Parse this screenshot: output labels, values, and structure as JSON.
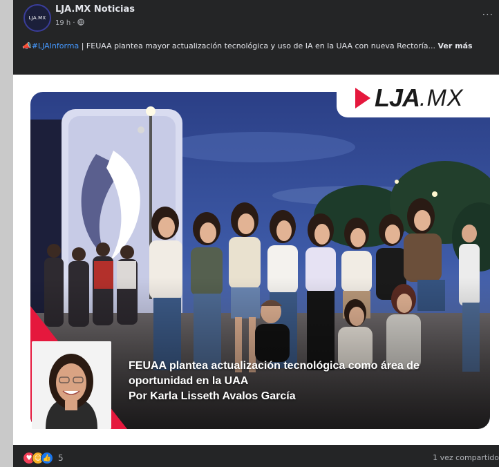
{
  "post": {
    "page_name": "LJA.MX Noticias",
    "avatar_text": "LJA.MX",
    "time": "19 h",
    "separator": " · ",
    "more_icon": "more-horizontal-icon",
    "emoji": "📣",
    "hashtag": "#LJAInforma",
    "text_after_hashtag": " | FEUAA plantea mayor actualización tecnológica y uso de IA en la UAA con nueva Rectoría...",
    "see_more": "Ver más"
  },
  "media": {
    "logo_main": "LJA",
    "logo_suffix": ".MX",
    "caption_line1": "FEUAA plantea actualización tecnológica como área de",
    "caption_line2": "oportunidad en la UAA",
    "caption_line3": "Por Karla Lisseth Avalos García"
  },
  "footer": {
    "reaction_count": "5",
    "reactions": [
      "love",
      "care",
      "like"
    ],
    "shares": "1 vez compartido"
  },
  "colors": {
    "card_bg": "#242526",
    "hashtag": "#4599ff",
    "brand_red": "#e5183d"
  }
}
